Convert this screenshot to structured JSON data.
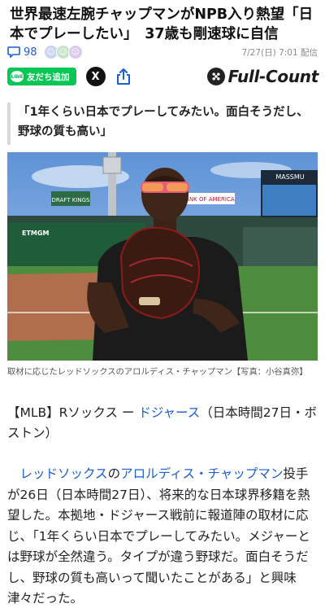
{
  "article": {
    "headline": "世界最速左腕チャップマンがNPB入り熱望「日本でプレーしたい」　37歳も剛速球に自信",
    "comments_count": "98",
    "date": "7/27(日) 7:01 配信",
    "line_button_label": "友だち追加",
    "line_logo_text": "LINE",
    "x_label": "X",
    "brand_name": "Full-Count",
    "quote": "「1年くらい日本でプレーしてみたい。面白そうだし、野球の質も高い」",
    "photo_signs": {
      "ad_banner": "BANK OF AMERICA",
      "left_wall": "ETMGM",
      "scoreboard": "MASSMU",
      "draft": "DRAFT KINGS"
    },
    "caption": "取材に応じたレッドソックスのアロルディス・チャップマン【写真：小谷真弥】",
    "dateline": {
      "prefix": "【MLB】Rソックス ー ",
      "link": "ドジャース",
      "suffix": "（日本時間27日・ボストン）"
    },
    "paragraph": {
      "indent": "　",
      "link1": "レッドソックス",
      "link1_after": "の",
      "link2": "アロルディス・チャップマン",
      "text": "投手が26日（日本時間27日）、将来的な日本球界移籍を熱望した。本拠地・ドジャース戦前に報道陣の取材に応じ、「1年くらい日本でプレーしてみたい。メジャーとは野球が全然違う。タイプが違う野球だ。面白そうだし、野球の質も高いって聞いたことがある」と興味津々だった。"
    }
  },
  "colors": {
    "accent_link": "#1a5fd0",
    "line_green": "#06c755"
  },
  "icons": [
    "comment-icon",
    "reaction-icon",
    "line-icon",
    "x-icon",
    "share-icon",
    "brand-icon"
  ]
}
